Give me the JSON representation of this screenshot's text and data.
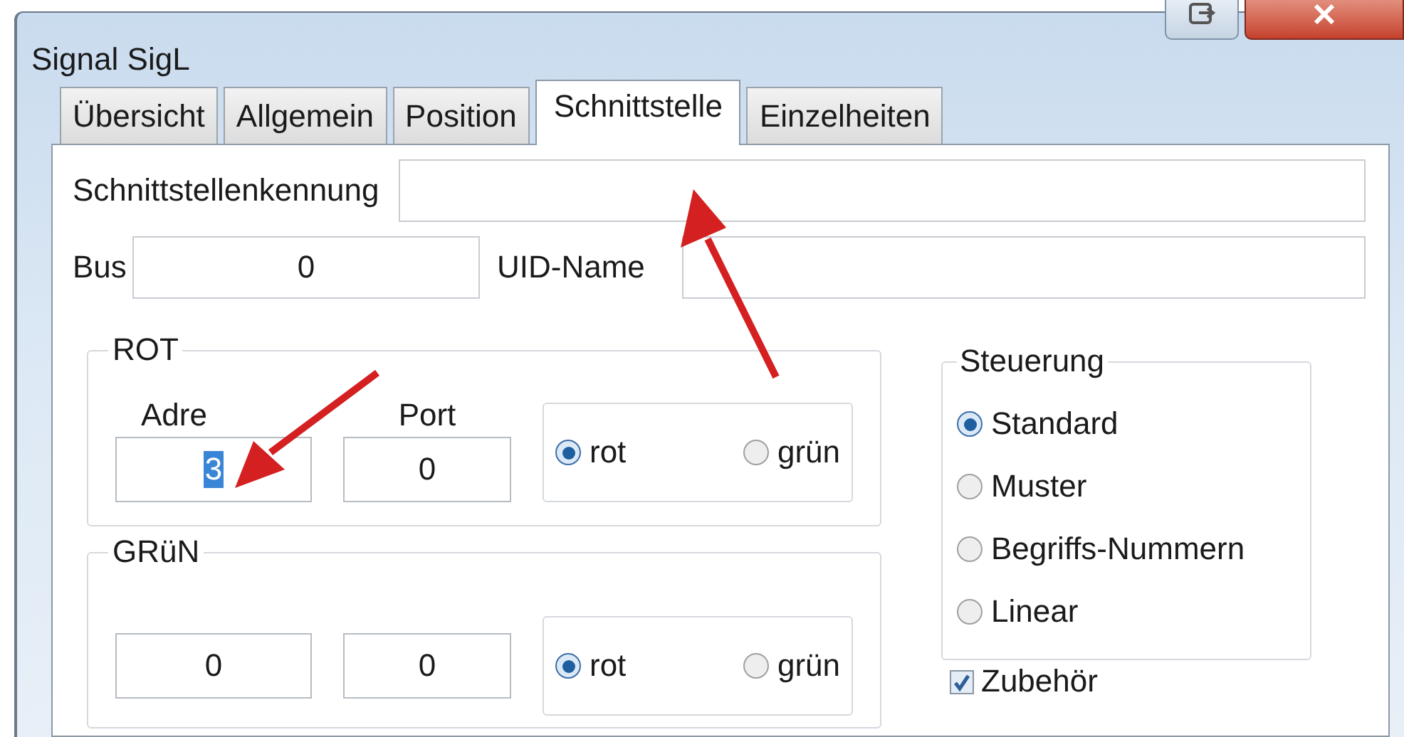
{
  "window": {
    "title": "Signal SigL"
  },
  "tabs": [
    {
      "label": "Übersicht",
      "selected": false
    },
    {
      "label": "Allgemein",
      "selected": false
    },
    {
      "label": "Position",
      "selected": false
    },
    {
      "label": "Schnittstelle",
      "selected": true
    },
    {
      "label": "Einzelheiten",
      "selected": false
    }
  ],
  "interface_id": {
    "label": "Schnittstellenkennung"
  },
  "bus": {
    "label": "Bus",
    "value": "0"
  },
  "uid_name": {
    "label": "UID-Name"
  },
  "groups": [
    {
      "title": "ROT",
      "address_label": "Adre",
      "port_label": "Port",
      "address": "3",
      "address_highlighted": true,
      "port": "0",
      "options": [
        {
          "label": "rot",
          "selected": true
        },
        {
          "label": "grün",
          "selected": false
        }
      ]
    },
    {
      "title": "GRüN",
      "address": "0",
      "address_highlighted": false,
      "port": "0",
      "options": [
        {
          "label": "rot",
          "selected": true
        },
        {
          "label": "grün",
          "selected": false
        }
      ]
    }
  ],
  "control": {
    "title": "Steuerung",
    "options": [
      {
        "label": "Standard",
        "selected": true
      },
      {
        "label": "Muster",
        "selected": false
      },
      {
        "label": "Begriffs-Nummern",
        "selected": false
      },
      {
        "label": "Linear",
        "selected": false
      }
    ]
  },
  "accessory": {
    "label": "Zubehör",
    "checked": true
  }
}
